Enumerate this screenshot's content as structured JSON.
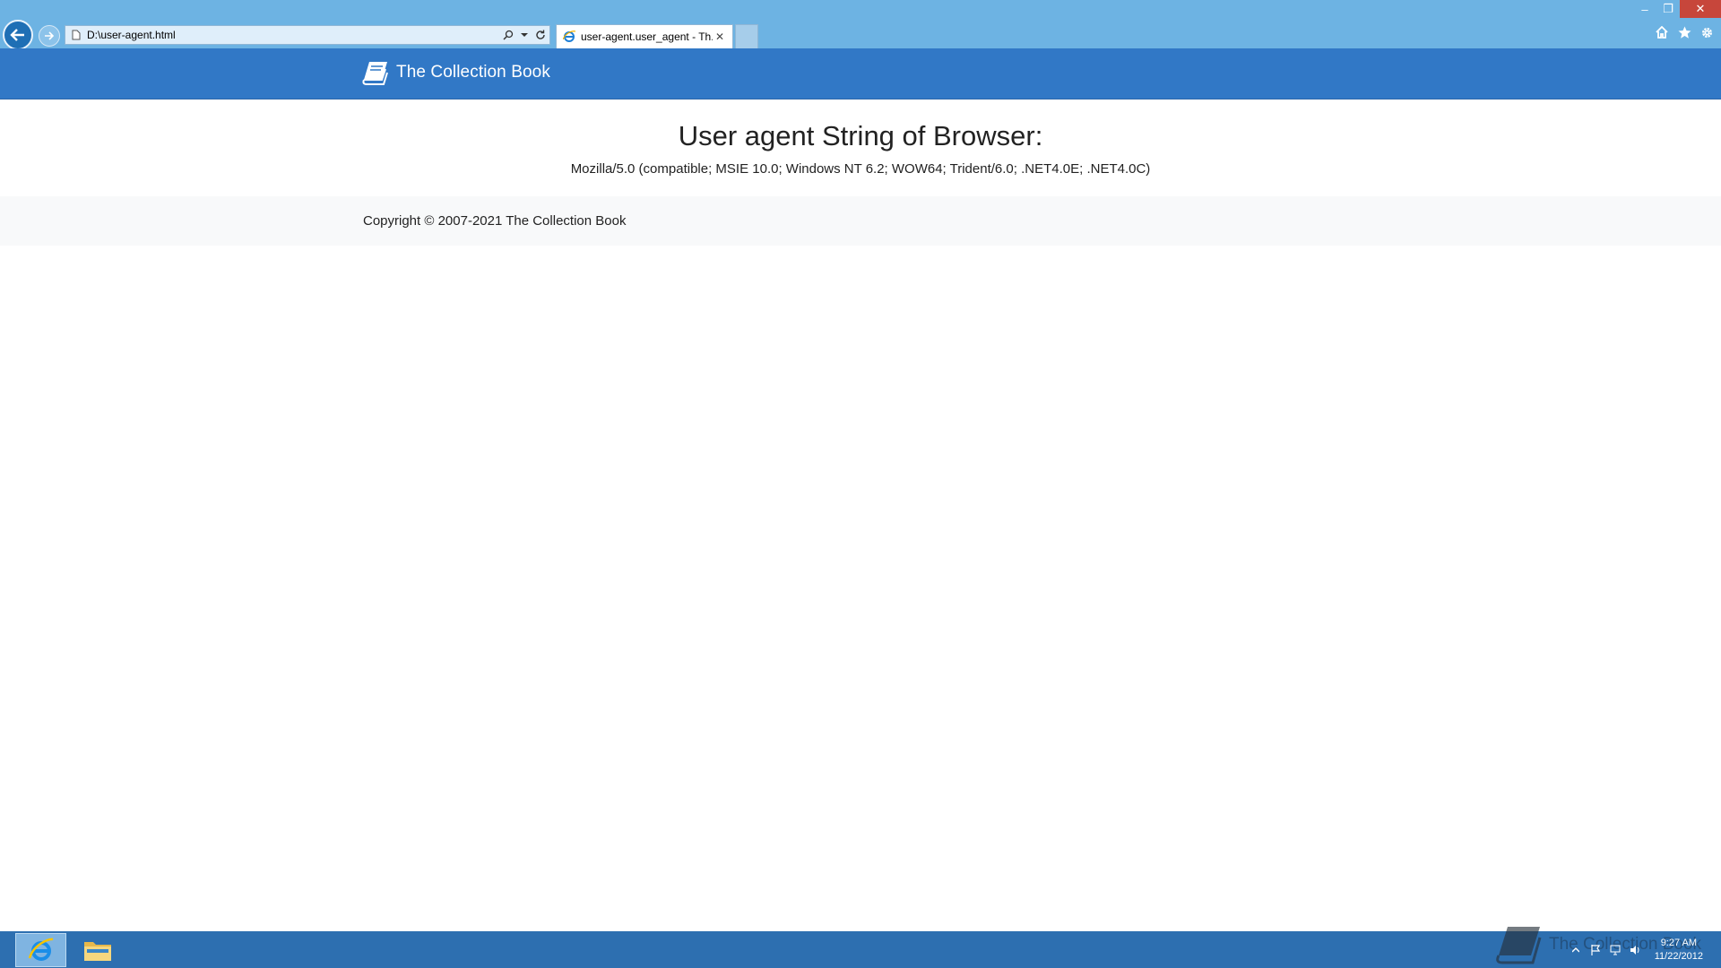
{
  "browser": {
    "address": "D:\\user-agent.html",
    "tab_title": "user-agent.user_agent - Th...",
    "tab_close": "✕",
    "window_controls": {
      "minimize": "–",
      "restore": "❐",
      "close": "✕"
    },
    "toolbar_icons": [
      "home-icon",
      "star-icon",
      "gear-icon"
    ]
  },
  "site": {
    "brand": "The Collection Book",
    "heading": "User agent String of Browser:",
    "user_agent": "Mozilla/5.0 (compatible; MSIE 10.0; Windows NT 6.2; WOW64; Trident/6.0; .NET4.0E; .NET4.0C)",
    "copyright": "Copyright © 2007-2021 The Collection Book"
  },
  "taskbar": {
    "apps": [
      "internet-explorer",
      "file-explorer"
    ],
    "watermark": "The Collection Book",
    "time": "9:27 AM",
    "date": "11/22/2012"
  },
  "colors": {
    "chrome": "#6db3e3",
    "header": "#3178c6",
    "footer": "#f8f9fa",
    "taskbar": "#2d6fb0"
  }
}
